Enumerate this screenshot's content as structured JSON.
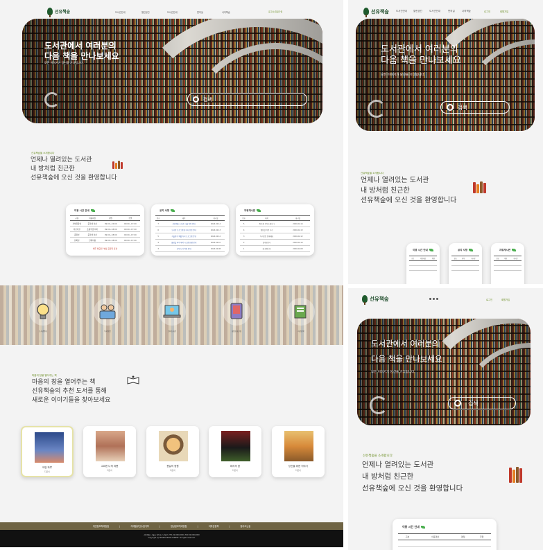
{
  "brand": {
    "name": "선유책숲",
    "accent": "#6b8e23",
    "logo_color": "#1f5a2d"
  },
  "nav": [
    "도서관안내",
    "열린공간",
    "도서관안내",
    "편의실",
    "나의책숲"
  ],
  "nav_tablet": [
    "도서관안내",
    "열린공간",
    "도서관안내",
    "편의실",
    "나의책숲"
  ],
  "util": {
    "login": "로그인/회원가입",
    "login_short": "로그인",
    "signup": "회원가입"
  },
  "hero": {
    "headline_1": "도서관에서 여러분의",
    "headline_2": "다음 책을 만나보세요",
    "sub": "모든 이야기가 당신을 기다립니다.",
    "search_label": "검색"
  },
  "intro": {
    "eyebrow": "선유책숲을 소개합니다",
    "line_1": "언제나 열려있는 도서관",
    "line_2": "내 방처럼 친근한",
    "line_3": "선유책숲에 오신 것을 환영합니다"
  },
  "hours_card": {
    "title": "이용 시간 안내",
    "headers": [
      "구분",
      "이용대상",
      "평일",
      "주말"
    ],
    "rows": [
      [
        "전체열람실",
        "중학생 이상",
        "09:00~22:00",
        "09:00~17:00"
      ],
      [
        "어린이실",
        "초등학생 이하",
        "09:00~18:00",
        "09:00~17:00"
      ],
      [
        "종합실",
        "중학생 이상",
        "09:00~18:00",
        "09:00~17:00"
      ],
      [
        "문화실",
        "전체이용",
        "09:00~18:00",
        "09:00~17:00"
      ]
    ],
    "note": "매주 월요일, 법정 공휴일 휴관"
  },
  "notice_card": {
    "title": "공지 사항",
    "headers": [
      "번호",
      "제목",
      "게시일"
    ],
    "rows": [
      [
        "7",
        "선유책숲 도서관 시설 이용 안내",
        "2024.02.14"
      ],
      [
        "6",
        "도서관 프로그램 참가자 모집 안내",
        "2024.02.13"
      ],
      [
        "5",
        "겨울방학 특별 독서 프로그램 운영",
        "2024.02.12"
      ],
      [
        "4",
        "열람실 좌석 예약 시스템 변경 안내",
        "2024.02.10"
      ],
      [
        "3",
        "신착 도서 목록 안내",
        "2024.02.08"
      ]
    ]
  },
  "free_card": {
    "title": "자유게시판",
    "headers": [
      "번호",
      "제목",
      "게시일"
    ],
    "rows": [
      [
        "5",
        "책 추천 부탁드립니다",
        "2024.02.14"
      ],
      [
        "4",
        "열람실 이용 후기",
        "2024.02.13"
      ],
      [
        "3",
        "독서모임 함께해요",
        "2024.02.12"
      ],
      [
        "2",
        "감사합니다",
        "2024.02.10"
      ],
      [
        "1",
        "첫 글입니다",
        "2024.02.08"
      ]
    ]
  },
  "services": [
    "도서관안내",
    "독서모임",
    "전자도서관",
    "희망도서신청",
    "자료검색"
  ],
  "recommend": {
    "eyebrow": "마음의 창을 열어주는 책",
    "line_1": "마음의 창을 열어주는 책",
    "line_2": "선유책숲의 추천 도서를 통해",
    "line_3": "새로운 이야기들을 찾아보세요"
  },
  "books": [
    {
      "title": "어떤 하루",
      "author": "지은이"
    },
    {
      "title": "고요한 나의 여름",
      "author": "지은이"
    },
    {
      "title": "봄날의 정원",
      "author": "지은이"
    },
    {
      "title": "파리의 밤",
      "author": "지은이"
    },
    {
      "title": "당신을 위한 이야기",
      "author": "지은이"
    }
  ],
  "footer": {
    "links": [
      "개인정보처리방침",
      "이메일무단수집거부",
      "영상정보처리방침",
      "저작권정책",
      "찾아오는길"
    ],
    "address": "선유책숲 | 서울시 영등포구 선유로 | TEL 02-000-0000 | FAX 02-000-0000",
    "copyright": "Copyright (c) SEONYU BOOK FOREST. All rights reserved."
  }
}
